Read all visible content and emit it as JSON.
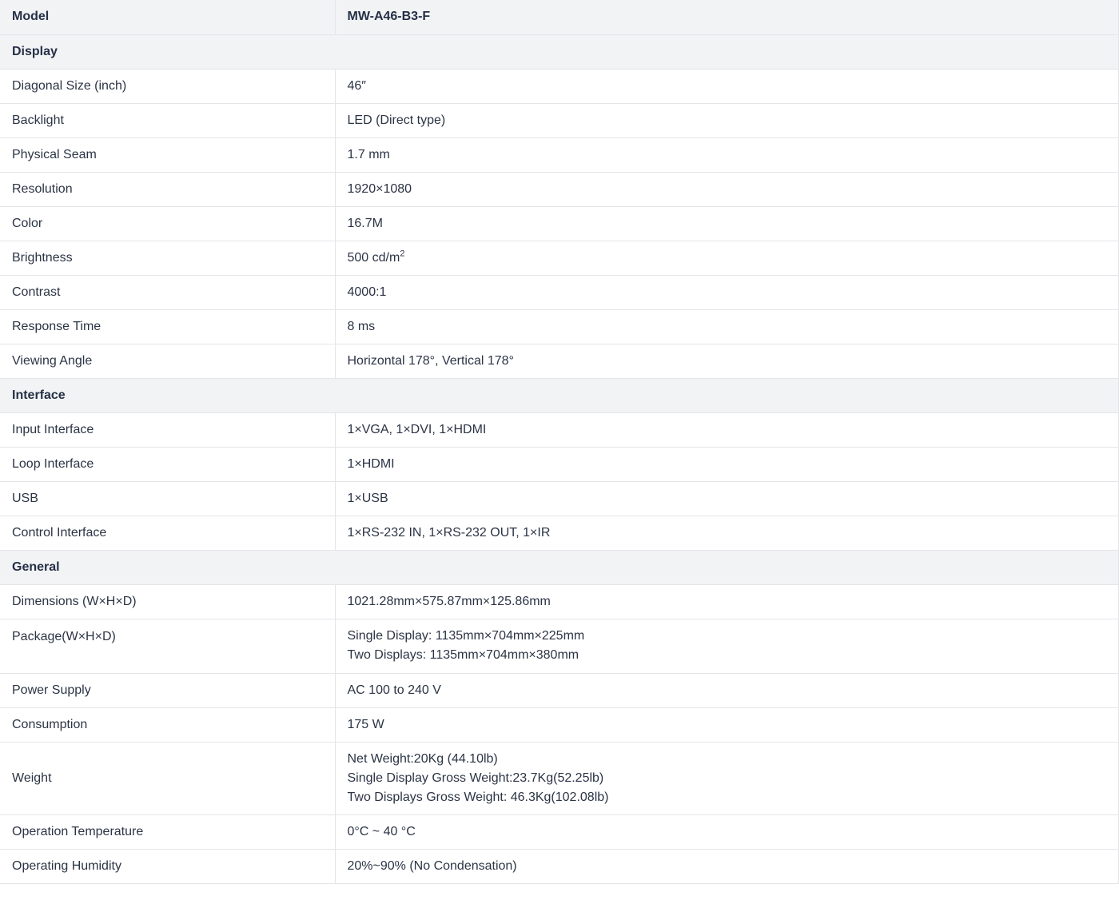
{
  "header": {
    "label": "Model",
    "value": "MW-A46-B3-F"
  },
  "sections": {
    "display": "Display",
    "interface": "Interface",
    "general": "General"
  },
  "display_rows": [
    {
      "label": "Diagonal Size (inch)",
      "value": "46″"
    },
    {
      "label": "Backlight",
      "value": "LED (Direct type)"
    },
    {
      "label": "Physical Seam",
      "value": "1.7 mm"
    },
    {
      "label": "Resolution",
      "value": "1920×1080"
    },
    {
      "label": "Color",
      "value": "16.7M"
    },
    {
      "label": "Brightness",
      "value": "500 cd/m",
      "value_sup": "2"
    },
    {
      "label": "Contrast",
      "value": "4000:1"
    },
    {
      "label": "Response Time",
      "value": "8 ms"
    },
    {
      "label": "Viewing Angle",
      "value": "Horizontal 178°, Vertical 178°"
    }
  ],
  "interface_rows": [
    {
      "label": "Input Interface",
      "value": "1×VGA, 1×DVI, 1×HDMI"
    },
    {
      "label": "Loop Interface",
      "value": "1×HDMI"
    },
    {
      "label": "USB",
      "value": "1×USB"
    },
    {
      "label": "Control Interface",
      "value": "1×RS-232 IN, 1×RS-232 OUT, 1×IR"
    }
  ],
  "general_rows": [
    {
      "label": "Dimensions (W×H×D)",
      "value": "1021.28mm×575.87mm×125.86mm"
    },
    {
      "label": "Package(W×H×D)",
      "lines": [
        "Single Display: 1135mm×704mm×225mm",
        "Two Displays: 1135mm×704mm×380mm"
      ]
    },
    {
      "label": "Power Supply",
      "value": "AC 100 to 240 V"
    },
    {
      "label": "Consumption",
      "value": "175 W"
    },
    {
      "label": "Weight",
      "lines": [
        "Net Weight:20Kg (44.10lb)",
        "Single Display Gross Weight:23.7Kg(52.25lb)",
        "Two Displays Gross Weight: 46.3Kg(102.08lb)"
      ]
    },
    {
      "label": "Operation Temperature",
      "value": "0°C ~ 40 °C"
    },
    {
      "label": "Operating Humidity",
      "value": "20%~90% (No Condensation)"
    }
  ]
}
